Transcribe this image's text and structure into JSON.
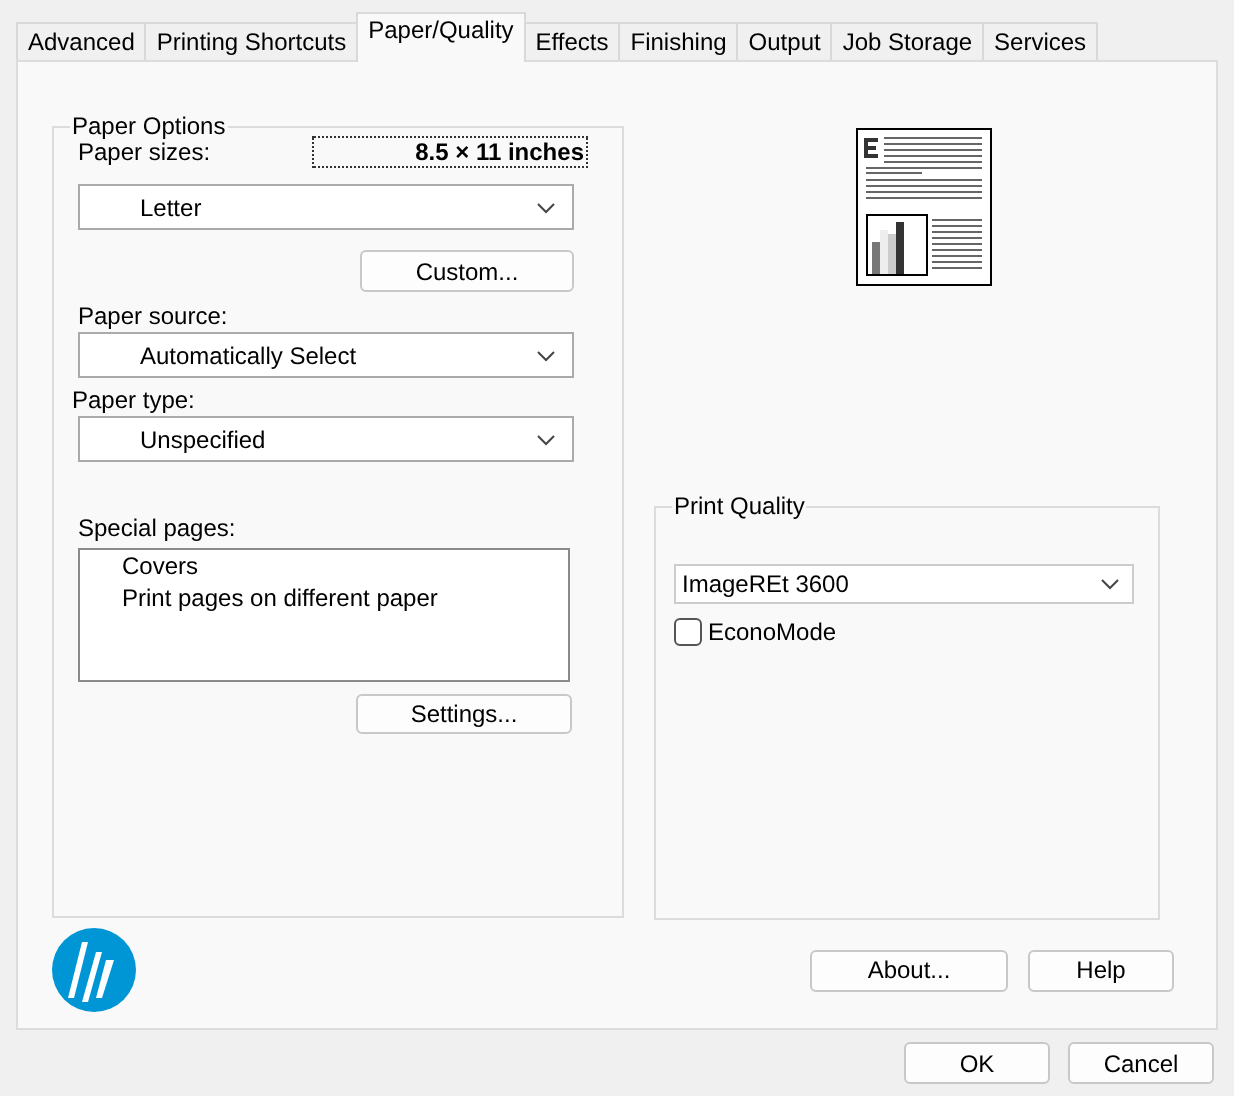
{
  "tabs": [
    {
      "label": "Advanced",
      "selected": false
    },
    {
      "label": "Printing Shortcuts",
      "selected": false
    },
    {
      "label": "Paper/Quality",
      "selected": true
    },
    {
      "label": "Effects",
      "selected": false
    },
    {
      "label": "Finishing",
      "selected": false
    },
    {
      "label": "Output",
      "selected": false
    },
    {
      "label": "Job Storage",
      "selected": false
    },
    {
      "label": "Services",
      "selected": false
    }
  ],
  "paper_options": {
    "title": "Paper Options",
    "paper_sizes": {
      "label": "Paper sizes:",
      "size": "8.5 × 11 inches",
      "value": "Letter"
    },
    "custom_button": "Custom...",
    "paper_source": {
      "label": "Paper source:",
      "value": "Automatically Select"
    },
    "paper_type": {
      "label": "Paper type:",
      "value": "Unspecified"
    },
    "special_pages": {
      "label": "Special pages:",
      "items": [
        "Covers",
        "Print pages on different paper"
      ]
    },
    "settings_button": "Settings..."
  },
  "print_quality": {
    "title": "Print Quality",
    "value": "ImageREt 3600",
    "econo_mode": {
      "label": "EconoMode",
      "checked": false
    }
  },
  "buttons": {
    "about": "About...",
    "help": "Help",
    "ok": "OK",
    "cancel": "Cancel"
  }
}
